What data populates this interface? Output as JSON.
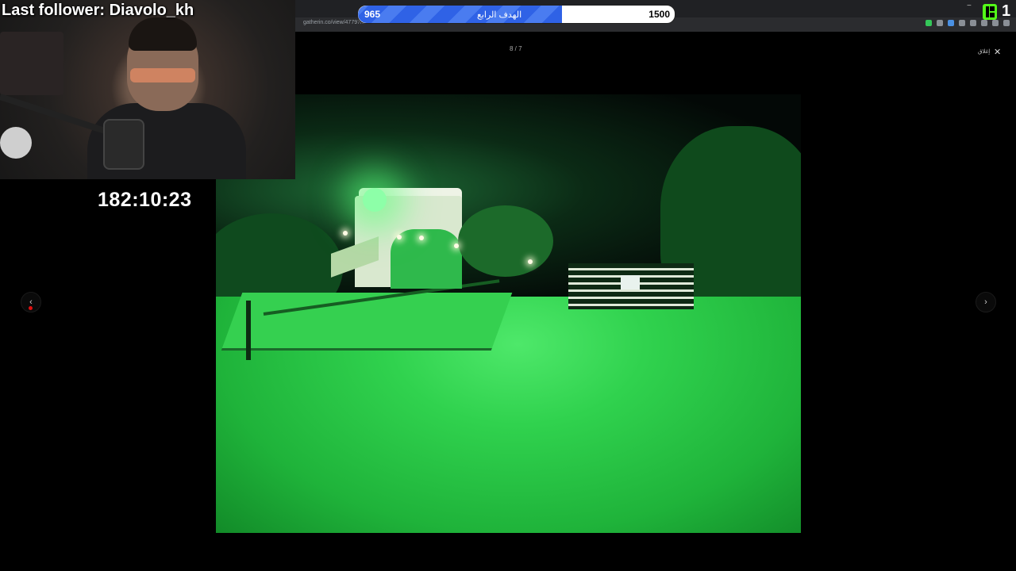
{
  "overlay": {
    "last_follower": "Last follower: Diavolo_kh",
    "timer": "182:10:23",
    "viewer_count": "1"
  },
  "goal": {
    "current": "965",
    "label": "الهدف الرابع",
    "target": "1500",
    "progress": 0.643,
    "fill_color": "#2f62e6"
  },
  "browser": {
    "url": "gatherin.co/view/47797/...",
    "minimize_glyph": "−"
  },
  "viewer": {
    "counter": "8 / 7",
    "close_glyph": "✕",
    "close_label": "إغلاق",
    "prev_glyph": "‹",
    "next_glyph": "›"
  },
  "icons": {
    "kick_logo": "kick-logo-icon",
    "close": "close-icon",
    "prev": "chevron-left-icon",
    "next": "chevron-right-icon"
  }
}
